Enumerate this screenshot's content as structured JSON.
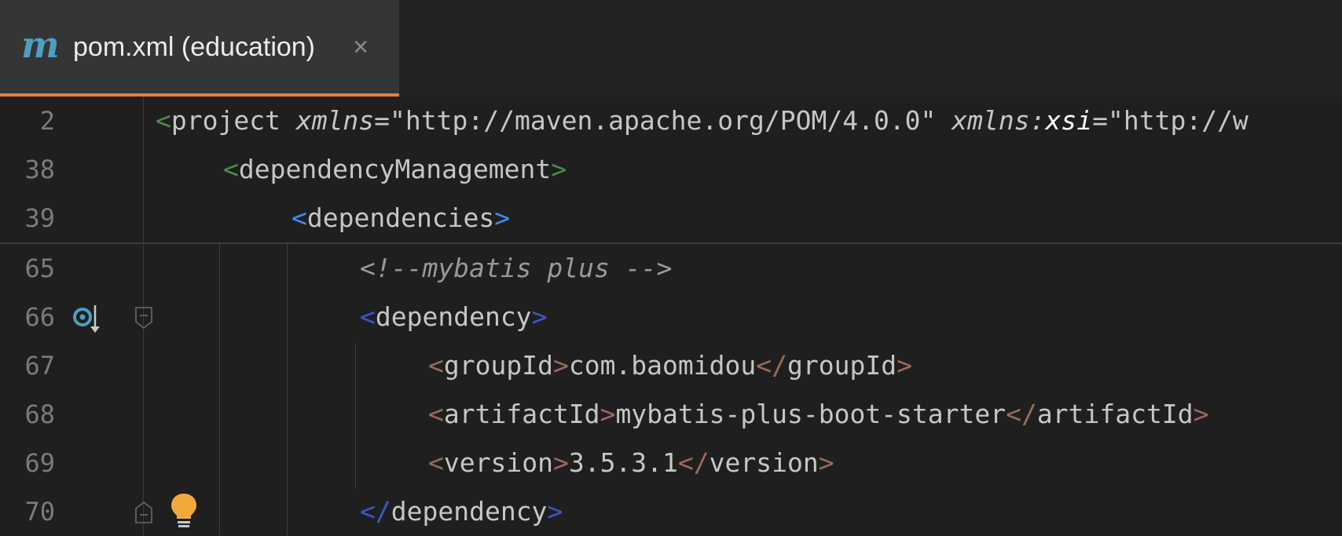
{
  "tab": {
    "icon_letter": "m",
    "title": "pom.xml (education)",
    "close_glyph": "×"
  },
  "lines": [
    {
      "number": "2",
      "tokens": [
        {
          "t": "<",
          "c": "lt-green"
        },
        {
          "t": "project",
          "c": "tagname"
        },
        {
          "t": " ",
          "c": "tagname"
        },
        {
          "t": "xmlns",
          "c": "attr"
        },
        {
          "t": "=\"http://maven.apache.org/POM/4.0.0\"",
          "c": "str"
        },
        {
          "t": " ",
          "c": "tagname"
        },
        {
          "t": "xmlns:",
          "c": "attr"
        },
        {
          "t": "xsi",
          "c": "attr-bright"
        },
        {
          "t": "=\"http://w",
          "c": "str"
        }
      ]
    },
    {
      "number": "38",
      "tokens": [
        {
          "t": "<",
          "c": "lt-green"
        },
        {
          "t": "dependencyManagement",
          "c": "tagname"
        },
        {
          "t": ">",
          "c": "lt-green"
        }
      ]
    },
    {
      "number": "39",
      "tokens": [
        {
          "t": "<",
          "c": "lt-blue"
        },
        {
          "t": "dependencies",
          "c": "tagname"
        },
        {
          "t": ">",
          "c": "lt-blue"
        }
      ]
    },
    {
      "number": "65",
      "tokens": [
        {
          "t": "<!--mybatis plus -->",
          "c": "comment"
        }
      ]
    },
    {
      "number": "66",
      "tokens": [
        {
          "t": "<",
          "c": "lt-navy"
        },
        {
          "t": "dependency",
          "c": "tagname"
        },
        {
          "t": ">",
          "c": "lt-navy"
        }
      ]
    },
    {
      "number": "67",
      "tokens": [
        {
          "t": "<",
          "c": "lt-brown"
        },
        {
          "t": "groupId",
          "c": "tagname"
        },
        {
          "t": ">",
          "c": "lt-brown"
        },
        {
          "t": "com.baomidou",
          "c": "tagname"
        },
        {
          "t": "</",
          "c": "lt-brown"
        },
        {
          "t": "groupId",
          "c": "tagname"
        },
        {
          "t": ">",
          "c": "lt-brown"
        }
      ]
    },
    {
      "number": "68",
      "tokens": [
        {
          "t": "<",
          "c": "lt-brown"
        },
        {
          "t": "artifactId",
          "c": "tagname"
        },
        {
          "t": ">",
          "c": "lt-brown"
        },
        {
          "t": "mybatis-plus-boot-starter",
          "c": "tagname"
        },
        {
          "t": "</",
          "c": "lt-brown"
        },
        {
          "t": "artifactId",
          "c": "tagname"
        },
        {
          "t": ">",
          "c": "lt-brown"
        }
      ]
    },
    {
      "number": "69",
      "tokens": [
        {
          "t": "<",
          "c": "lt-brown"
        },
        {
          "t": "version",
          "c": "tagname"
        },
        {
          "t": ">",
          "c": "lt-brown"
        },
        {
          "t": "3.5.3.1",
          "c": "tagname"
        },
        {
          "t": "</",
          "c": "lt-brown"
        },
        {
          "t": "version",
          "c": "tagname"
        },
        {
          "t": ">",
          "c": "lt-brown"
        }
      ]
    },
    {
      "number": "70",
      "tokens": [
        {
          "t": "</",
          "c": "lt-navy"
        },
        {
          "t": "dependency",
          "c": "tagname"
        },
        {
          "t": ">",
          "c": "lt-navy"
        }
      ]
    }
  ],
  "gutter_icons": {
    "line_66": "maven-dependency-icon",
    "line_70": "intention-bulb-icon"
  },
  "colors": {
    "tab_accent": "#e8812f",
    "maven_icon": "#4d9fc2",
    "bulb": "#f2a93b"
  }
}
